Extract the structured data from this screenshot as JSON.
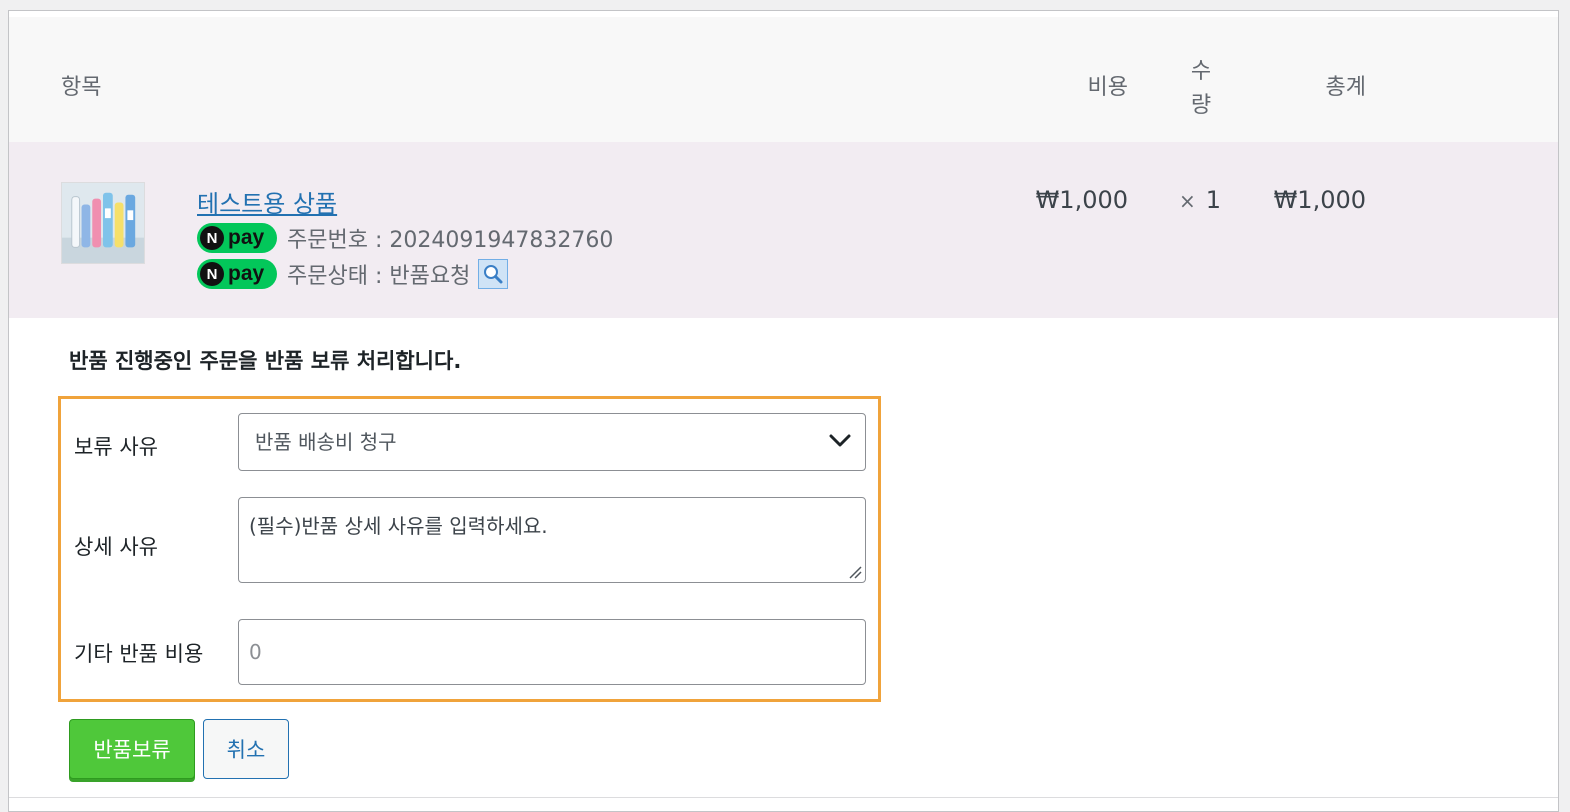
{
  "table": {
    "headers": {
      "item": "항목",
      "cost": "비용",
      "qty": "수량",
      "total": "총계"
    },
    "row": {
      "product_name": "테스트용 상품",
      "npay_badge": {
        "n": "N",
        "pay": "pay"
      },
      "order_no_text": "주문번호 : 2024091947832760",
      "order_status_text": "주문상태 : 반품요청",
      "cost": "₩1,000",
      "qty_symbol": "×",
      "qty": "1",
      "total": "₩1,000"
    }
  },
  "hold_form": {
    "notice": "반품 진행중인 주문을 반품 보류 처리합니다.",
    "reason_label": "보류 사유",
    "reason_selected": "반품 배송비 청구",
    "detail_label": "상세 사유",
    "detail_placeholder": "(필수)반품 상세 사유를 입력하세요.",
    "extra_cost_label": "기타 반품 비용",
    "extra_cost_value": "0",
    "hold_button": "반품보류",
    "cancel_button": "취소"
  },
  "colors": {
    "accent_border": "#f0a33b",
    "hold_button": "#4fc83a",
    "link": "#2271b1",
    "npay": "#03c75a",
    "row_highlight": "#f2ecf2"
  },
  "icons": [
    "npay-badge-icon",
    "magnifier-icon",
    "chevron-down-icon",
    "resize-grip-icon"
  ]
}
